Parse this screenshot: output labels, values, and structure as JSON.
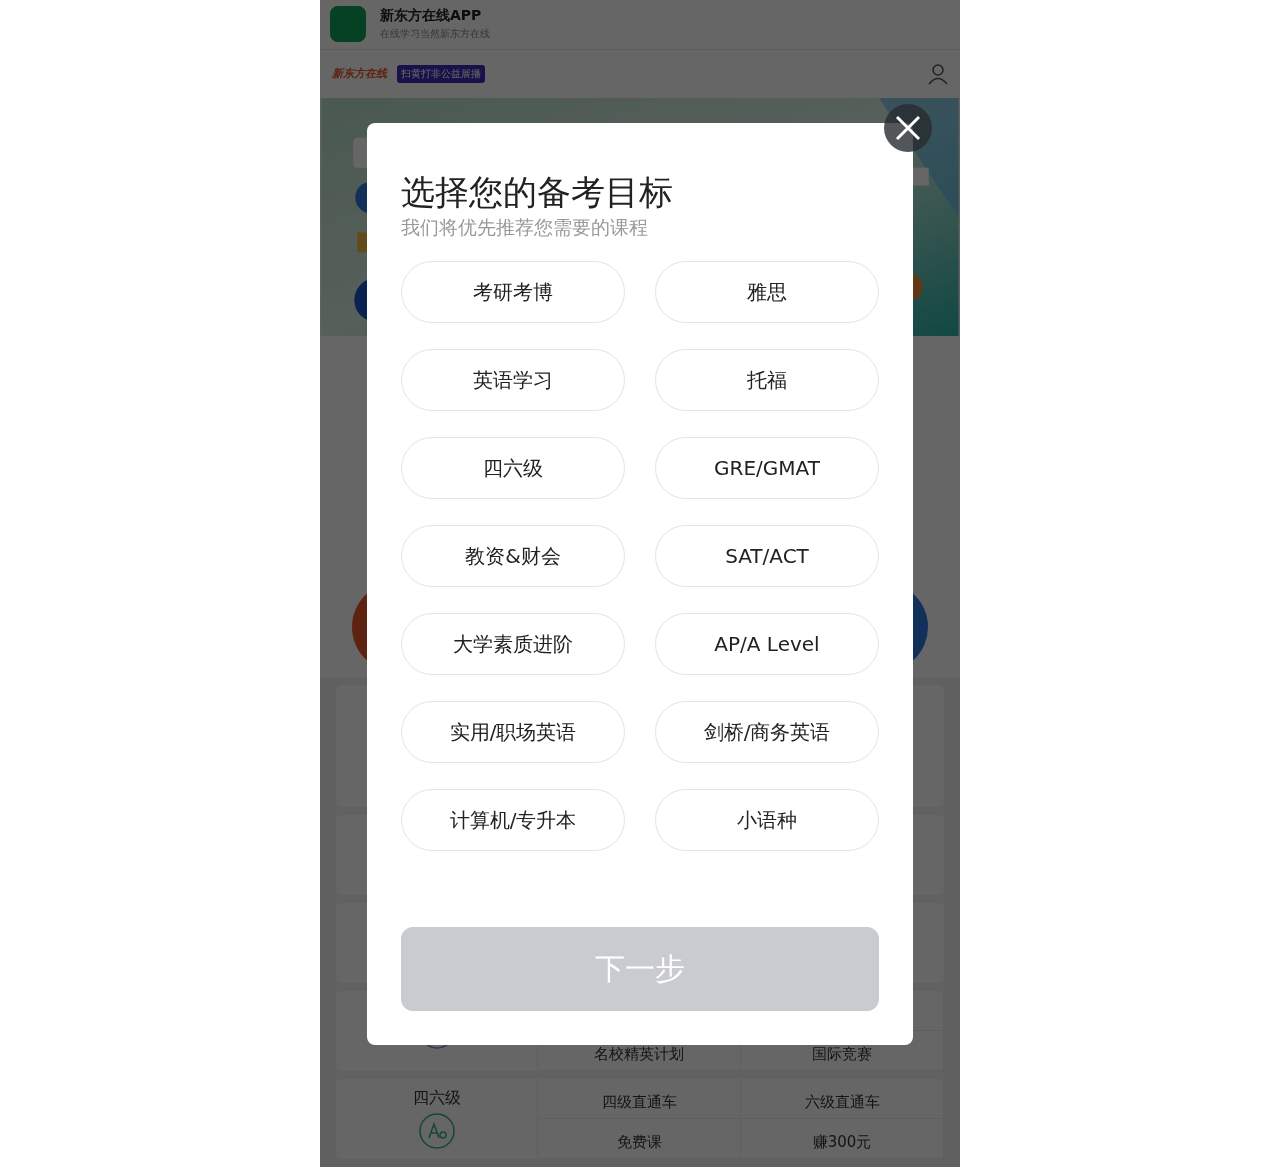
{
  "app_banner": {
    "title": "新东方在线APP",
    "subtitle": "在线学习当然新东方在线"
  },
  "nav": {
    "logo": "新东方在线",
    "badge": "扫黄打非公益展播"
  },
  "course_cards": [
    {
      "kind": "seal",
      "rows": [
        [
          "名校精英计划",
          "国际竞赛"
        ]
      ]
    },
    {
      "kind": "letters",
      "title": "四六级",
      "rows": [
        [
          "四级直通车",
          "六级直通车"
        ],
        [
          "免费课",
          "赚300元"
        ]
      ]
    }
  ],
  "modal": {
    "title": "选择您的备考目标",
    "subtitle": "我们将优先推荐您需要的课程",
    "options": [
      {
        "label": "考研考博",
        "selected": false
      },
      {
        "label": "雅思",
        "selected": false
      },
      {
        "label": "英语学习",
        "selected": false
      },
      {
        "label": "托福",
        "selected": false
      },
      {
        "label": "四六级",
        "selected": false
      },
      {
        "label": "GRE/GMAT",
        "selected": false
      },
      {
        "label": "教资&财会",
        "selected": false
      },
      {
        "label": "SAT/ACT",
        "selected": false
      },
      {
        "label": "大学素质进阶",
        "selected": false
      },
      {
        "label": "AP/A Level",
        "selected": false
      },
      {
        "label": "实用/职场英语",
        "selected": false
      },
      {
        "label": "剑桥/商务英语",
        "selected": false
      },
      {
        "label": "计算机/专升本",
        "selected": false
      },
      {
        "label": "小语种",
        "selected": false
      }
    ],
    "next_button": {
      "label": "下一步",
      "disabled": true
    }
  }
}
